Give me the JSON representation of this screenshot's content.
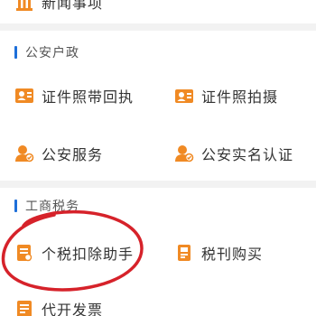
{
  "top_item": {
    "label": "新闻事项",
    "icon": "building-icon"
  },
  "sections": [
    {
      "title": "公安户政",
      "items": [
        {
          "label": "证件照带回执",
          "icon": "id-photo-icon"
        },
        {
          "label": "证件照拍摄",
          "icon": "camera-photo-icon"
        },
        {
          "label": "公安服务",
          "icon": "police-user-icon"
        },
        {
          "label": "公安实名认证",
          "icon": "police-verify-icon"
        }
      ]
    },
    {
      "title": "工商税务",
      "items": [
        {
          "label": "个税扣除助手",
          "icon": "tax-document-icon"
        },
        {
          "label": "税刊购买",
          "icon": "tax-book-icon"
        },
        {
          "label": "代开发票",
          "icon": "invoice-icon"
        }
      ]
    }
  ],
  "colors": {
    "icon_orange": "#f08a24",
    "accent_blue": "#1e6fd9",
    "annotation_red": "#d6222a"
  }
}
